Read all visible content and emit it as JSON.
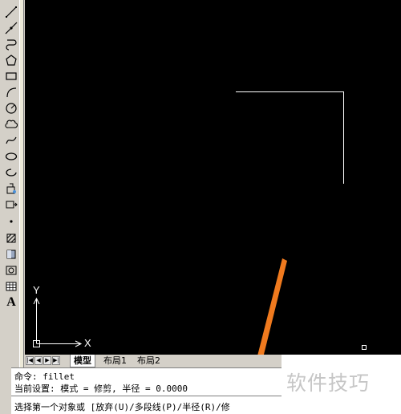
{
  "canvas": {
    "background": "#000000",
    "ucs_y_label": "Y",
    "ucs_x_label": "X"
  },
  "toolbar": {
    "tools": [
      "line-icon",
      "construction-line-icon",
      "polyline-icon",
      "polygon-icon",
      "rectangle-icon",
      "arc-icon",
      "circle-icon",
      "revision-cloud-icon",
      "spline-icon",
      "ellipse-icon",
      "ellipse-arc-icon",
      "insert-block-icon",
      "make-block-icon",
      "point-icon",
      "hatch-icon",
      "gradient-icon",
      "region-icon",
      "table-icon",
      "multiline-text-icon"
    ],
    "text_tool_label": "A"
  },
  "tabs": {
    "items": [
      "模型",
      "布局1",
      "布局2"
    ]
  },
  "command": {
    "line1": "命令:  fillet",
    "line2": "当前设置: 模式 = 修剪, 半径 = 0.0000",
    "prompt": "选择第一个对象或 [放弃(U)/多段线(P)/半径(R)/修"
  },
  "watermark": {
    "text": "软件技巧"
  },
  "colors": {
    "arrow": "#f07a1e",
    "drawing_lines": "#ffffff"
  }
}
